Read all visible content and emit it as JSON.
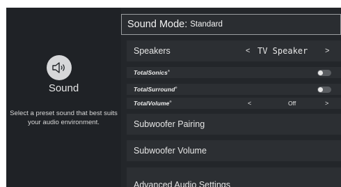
{
  "left_panel": {
    "title": "Sound",
    "description": "Select a preset sound that best suits your audio environment."
  },
  "header": {
    "label": "Sound Mode:",
    "value": "Standard"
  },
  "speakers": {
    "label": "Speakers",
    "value": "TV Speaker"
  },
  "total_sonics": {
    "label": "TotalSonics",
    "mark": "®",
    "state": "off"
  },
  "total_surround": {
    "label": "TotalSurround",
    "mark": "®",
    "state": "off"
  },
  "total_volume": {
    "label": "TotalVolume",
    "mark": "®",
    "value": "Off"
  },
  "menu": {
    "subwoofer_pairing": "Subwoofer Pairing",
    "subwoofer_volume": "Subwoofer Volume",
    "advanced_audio": "Advanced Audio Settings"
  },
  "arrows": {
    "left": "<",
    "right": ">"
  },
  "icons": {
    "sound": "speaker-icon"
  }
}
